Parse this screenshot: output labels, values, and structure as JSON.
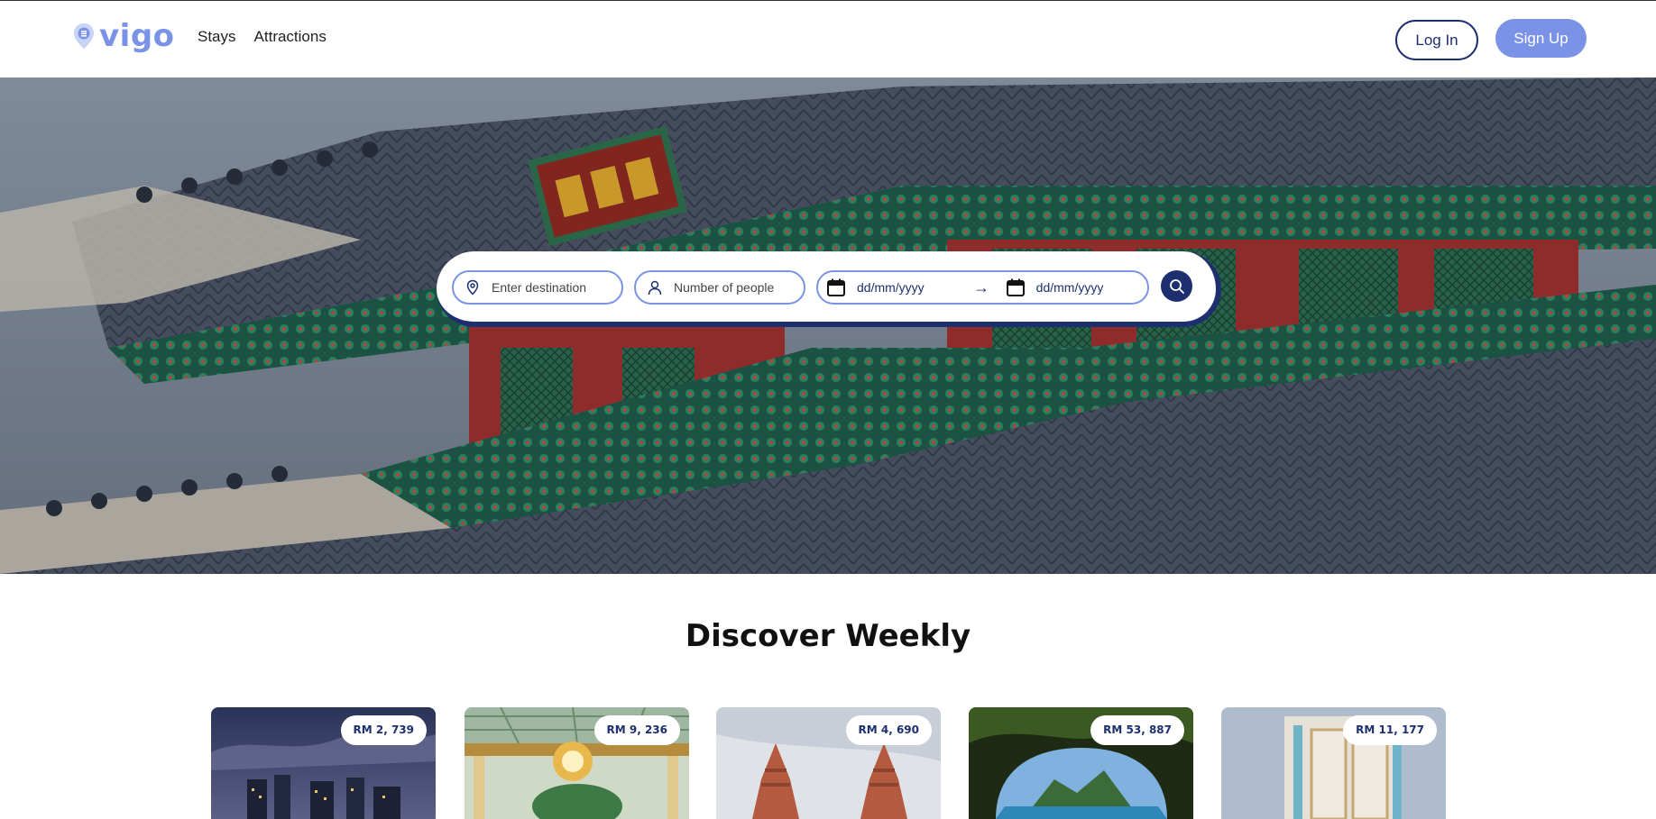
{
  "brand": {
    "name": "vigo",
    "color": "#7b93e6"
  },
  "nav": {
    "items": [
      "Stays",
      "Attractions"
    ]
  },
  "auth": {
    "login_label": "Log In",
    "signup_label": "Sign Up"
  },
  "colors": {
    "navy": "#1d2f6f",
    "accent": "#7b93e6"
  },
  "search": {
    "destination_placeholder": "Enter destination",
    "people_placeholder": "Number of people",
    "checkin_placeholder": "dd/mm/yyyy",
    "checkout_placeholder": "dd/mm/yyyy",
    "arrow": "→"
  },
  "discover": {
    "title": "Discover Weekly",
    "cards": [
      {
        "price": "RM 2, 739"
      },
      {
        "price": "RM 9, 236"
      },
      {
        "price": "RM 4, 690"
      },
      {
        "price": "RM 53, 887"
      },
      {
        "price": "RM 11, 177"
      }
    ]
  }
}
